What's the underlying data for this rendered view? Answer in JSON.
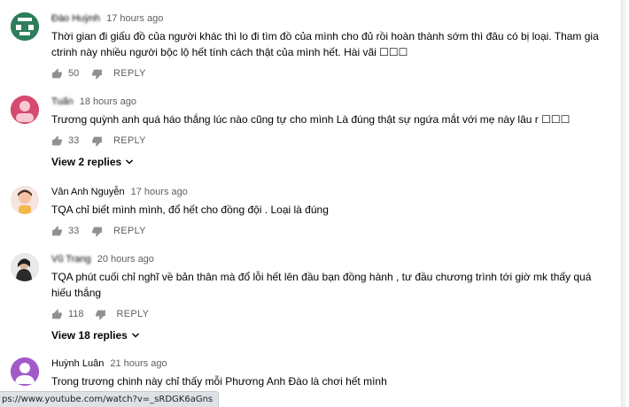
{
  "comments": [
    {
      "author": "Đào Huỳnh",
      "time": "17 hours ago",
      "text": "Thời gian đi giấu đồ của người khác thì lo đi tìm đồ của mình cho đủ rồi hoàn thành sớm thì đâu có bị loại. Tham gia ctrinh này nhiều người bộc lộ hết tính cách thật của mình hết. Hài vãi ☐☐☐",
      "likes": "50",
      "reply": "REPLY",
      "avatar_color": "#2e7d5b"
    },
    {
      "author": "Tuấn",
      "time": "18 hours ago",
      "text": "Trương quỳnh anh quá háo thắng lúc nào cũng tự cho mình Là đúng thật sự ngứa mắt với mẹ này lâu r ☐☐☐",
      "likes": "33",
      "reply": "REPLY",
      "view_replies": "View 2 replies",
      "avatar_color": "#d64a6f"
    },
    {
      "author": "Vân Anh Nguyễn",
      "time": "17 hours ago",
      "text": "TQA chỉ biết mình mình, đổ hết cho đồng đội . Loại là đúng",
      "likes": "33",
      "reply": "REPLY",
      "avatar_color": "#f3d6d0"
    },
    {
      "author": "Vũ Trang",
      "time": "20 hours ago",
      "text": "TQA phút cuối chỉ nghĩ về bản thân mà đổ lỗi hết lên đầu bạn đồng hành , tư đầu chương trình tới giờ mk thấy quá hiếu thắng",
      "likes": "118",
      "reply": "REPLY",
      "view_replies": "View 18 replies",
      "avatar_color": "#cfcfcf"
    },
    {
      "author": "Huỳnh Luân",
      "time": "21 hours ago",
      "text": "Trong trương chinh này chỉ thấy mỗi Phương Anh Đào là chơi hết mình",
      "avatar_color": "#a259c9"
    }
  ],
  "status_url": "ps://www.youtube.com/watch?v=_sRDGK6aGns"
}
